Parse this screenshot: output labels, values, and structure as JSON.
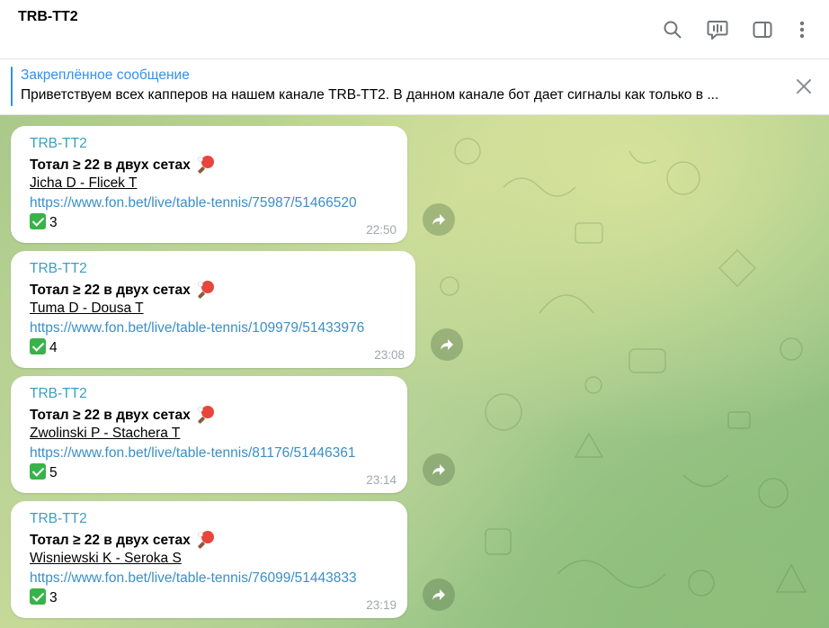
{
  "header": {
    "title": "TRB-TT2"
  },
  "pinned": {
    "title": "Закреплённое сообщение",
    "text": "Приветствуем всех капперов на нашем канале TRB-TT2. В данном канале бот дает сигналы как только в ..."
  },
  "messages": [
    {
      "sender": "TRB-TT2",
      "headline": "Тотал ≥ 22 в двух сетах",
      "match": "Jicha D - Flicek T",
      "link": "https://www.fon.bet/live/table-tennis/75987/51466520",
      "result": "3",
      "time": "22:50"
    },
    {
      "sender": "TRB-TT2",
      "headline": "Тотал ≥ 22 в двух сетах",
      "match": "Tuma D - Dousa T",
      "link": "https://www.fon.bet/live/table-tennis/109979/51433976",
      "result": "4",
      "time": "23:08"
    },
    {
      "sender": "TRB-TT2",
      "headline": "Тотал ≥ 22 в двух сетах",
      "match": "Zwolinski P - Stachera T",
      "link": "https://www.fon.bet/live/table-tennis/81176/51446361",
      "result": "5",
      "time": "23:14"
    },
    {
      "sender": "TRB-TT2",
      "headline": "Тотал ≥ 22 в двух сетах",
      "match": "Wisniewski K - Seroka S",
      "link": "https://www.fon.bet/live/table-tennis/76099/51443833",
      "result": "3",
      "time": "23:19"
    }
  ],
  "icons": {
    "search": "search-icon",
    "video_chat": "video-chat-icon",
    "sidebar": "sidebar-toggle-icon",
    "more": "more-vertical-icon",
    "close": "close-icon",
    "forward": "forward-icon",
    "check": "check-mark-icon",
    "ping_pong": "ping-pong-icon"
  },
  "colors": {
    "accent": "#3390ec",
    "sender": "#3a9fbf",
    "link": "#3a8fc7",
    "check": "#38b34a"
  }
}
